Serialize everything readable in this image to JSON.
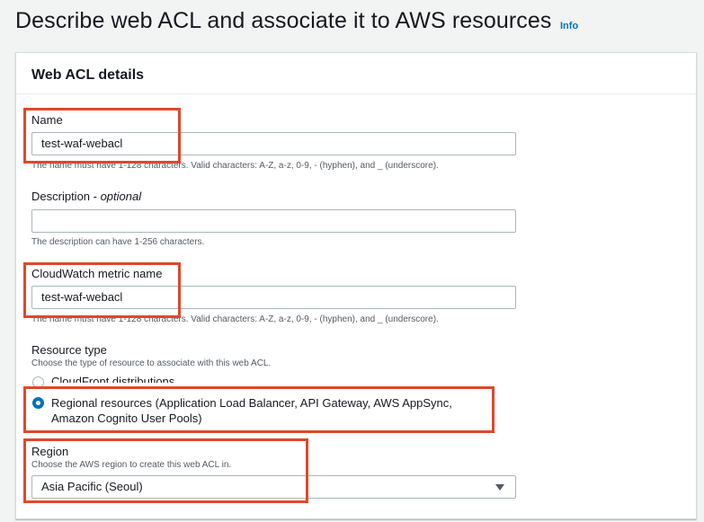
{
  "page": {
    "title": "Describe web ACL and associate it to AWS resources",
    "info_link": "Info"
  },
  "panel": {
    "title": "Web ACL details"
  },
  "name_field": {
    "label": "Name",
    "value": "test-waf-webacl",
    "hint": "The name must have 1-128 characters. Valid characters: A-Z, a-z, 0-9, - (hyphen), and _ (underscore)."
  },
  "description_field": {
    "label": "Description - ",
    "label_optional": "optional",
    "value": "",
    "hint": "The description can have 1-256 characters."
  },
  "metric_field": {
    "label": "CloudWatch metric name",
    "value": "test-waf-webacl",
    "hint": "The name must have 1-128 characters. Valid characters: A-Z, a-z, 0-9, - (hyphen), and _ (underscore)."
  },
  "resource_type": {
    "label": "Resource type",
    "hint": "Choose the type of resource to associate with this web ACL.",
    "options": [
      {
        "label": "CloudFront distributions",
        "selected": false
      },
      {
        "label": "Regional resources (Application Load Balancer, API Gateway, AWS AppSync, Amazon Cognito User Pools)",
        "selected": true
      }
    ]
  },
  "region": {
    "label": "Region",
    "hint": "Choose the AWS region to create this web ACL in.",
    "selected": "Asia Pacific (Seoul)"
  },
  "colors": {
    "highlight": "#e0482a",
    "accent": "#0073bb"
  },
  "icons": {
    "select": "caret-down-icon"
  }
}
